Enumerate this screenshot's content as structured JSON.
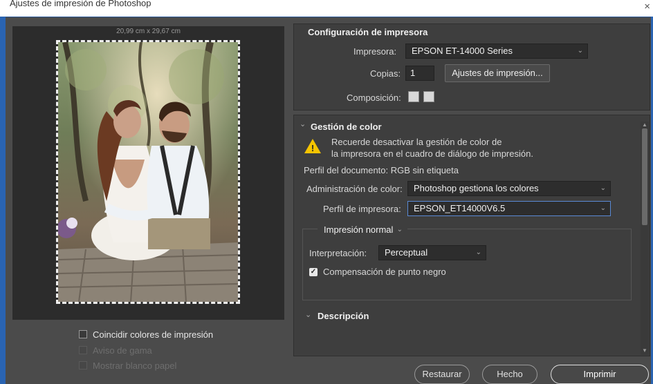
{
  "window": {
    "title": "Ajustes de impresión de Photoshop",
    "close_icon": "×"
  },
  "preview": {
    "paper_size": "20,99 cm x 29,67 cm"
  },
  "options": [
    {
      "label": "Coincidir colores de impresión",
      "checked": false,
      "enabled": true
    },
    {
      "label": "Aviso de gama",
      "checked": false,
      "enabled": false
    },
    {
      "label": "Mostrar blanco papel",
      "checked": false,
      "enabled": false
    }
  ],
  "printer_setup": {
    "title": "Configuración de impresora",
    "printer_label": "Impresora:",
    "printer_value": "EPSON ET-14000 Series",
    "copies_label": "Copias:",
    "copies_value": "1",
    "print_settings_button": "Ajustes de impresión...",
    "layout_label": "Composición:"
  },
  "color_management": {
    "title": "Gestión de color",
    "warning_line1": "Recuerde desactivar la gestión de color de",
    "warning_line2": "la impresora en el cuadro de diálogo de impresión.",
    "doc_profile": "Perfil del documento: RGB sin etiqueta",
    "color_handling_label": "Administración de color:",
    "color_handling_value": "Photoshop gestiona los colores",
    "printer_profile_label": "Perfil de impresora:",
    "printer_profile_value": "EPSON_ET14000V6.5",
    "print_mode": "Impresión normal",
    "rendering_intent_label": "Interpretación:",
    "rendering_intent_value": "Perceptual",
    "black_point_label": "Compensación de punto negro",
    "black_point_checked": true
  },
  "description": {
    "title": "Descripción"
  },
  "footer": {
    "reset": "Restaurar",
    "done": "Hecho",
    "print": "Imprimir"
  }
}
